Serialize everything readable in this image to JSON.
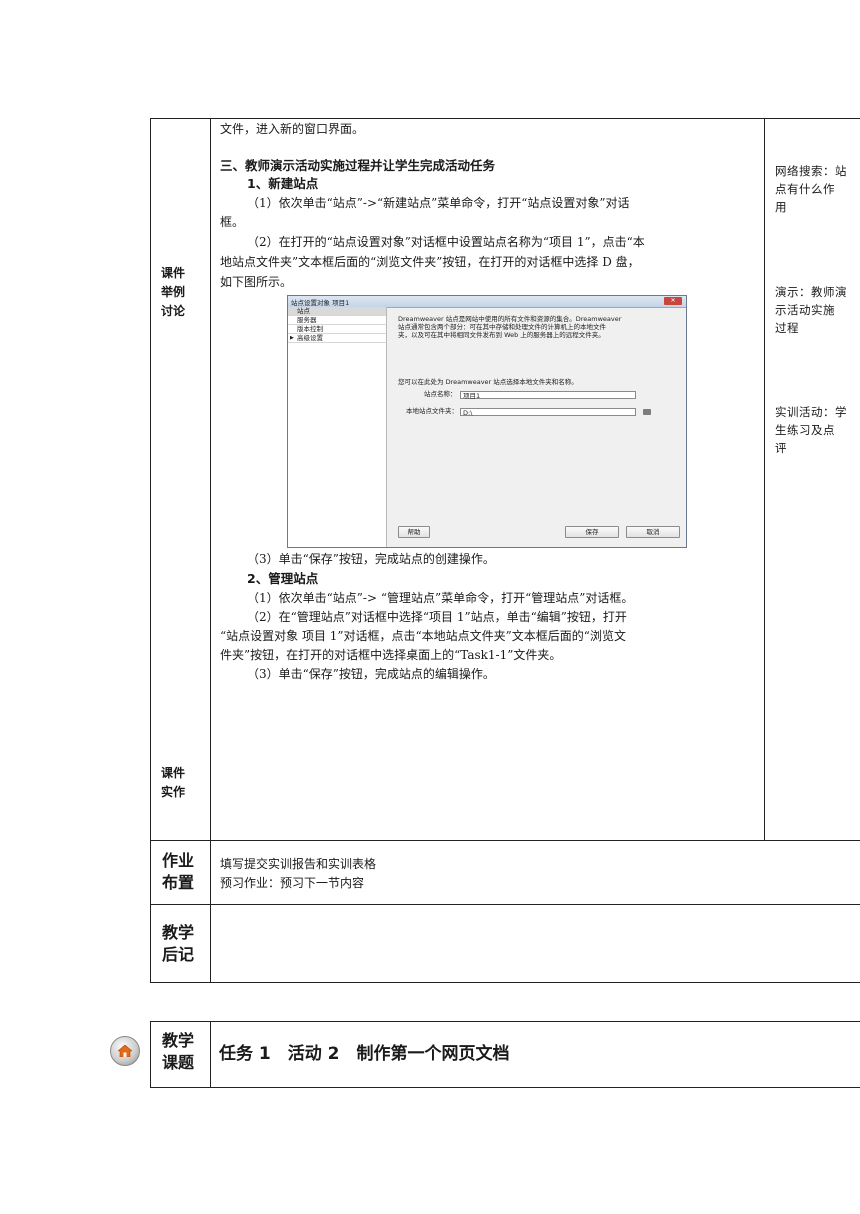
{
  "row_labels": {
    "courseware_example": [
      "课件",
      "举例",
      "讨论"
    ],
    "courseware_practice": [
      "课件",
      "实作"
    ],
    "homework": [
      "作业",
      "布置"
    ],
    "postscript": [
      "教学",
      "后记"
    ],
    "topic": [
      "教学",
      "课题"
    ]
  },
  "content": {
    "lines": [
      "文件，进入新的窗口界面。",
      "三、教师演示活动实施过程并让学生完成活动任务",
      "1、新建站点",
      "（1）依次单击“站点”->“新建站点”菜单命令，打开“站点设置对象”对话",
      "框。",
      "（2）在打开的“站点设置对象”对话框中设置站点名称为“项目 1”，点击“本",
      "地站点文件夹”文本框后面的“浏览文件夹”按钮，在打开的对话框中选择 D 盘，",
      "如下图所示。",
      "（3）单击“保存”按钮，完成站点的创建操作。",
      "2、管理站点",
      "（1）依次单击“站点”-> “管理站点”菜单命令，打开“管理站点”对话框。",
      "（2）在“管理站点”对话框中选择“项目 1”站点，单击“编辑”按钮，打开",
      "“站点设置对象 项目 1”对话框，点击“本地站点文件夹”文本框后面的“浏览文",
      "件夹”按钮，在打开的对话框中选择桌面上的“Task1-1”文件夹。",
      "（3）单击“保存”按钮，完成站点的编辑操作。"
    ]
  },
  "dialog": {
    "title": "站点设置对象 项目1",
    "close": "✕",
    "nav": [
      "站点",
      "服务器",
      "版本控制",
      "高级设置"
    ],
    "description": [
      "Dreamweaver 站点是网站中使用的所有文件和资源的集合。Dreamweaver",
      "站点通常包含两个部分：可在其中存储和处理文件的计算机上的本地文件",
      "夹，以及可在其中将相同文件发布到 Web 上的服务器上的远程文件夹。"
    ],
    "hint": "您可以在此处为 Dreamweaver 站点选择本地文件夹和名称。",
    "site_name_label": "站点名称：",
    "site_name_value": "项目1",
    "local_folder_label": "本地站点文件夹：",
    "local_folder_value": "D:\\",
    "help_button": "帮助",
    "save_button": "保存",
    "cancel_button": "取消"
  },
  "side_notes": [
    [
      "网络搜索：站",
      "点有什么作",
      "用"
    ],
    [
      "演示：教师演",
      "示活动实施",
      "过程"
    ],
    [
      "实训活动：学",
      "生练习及点",
      "评"
    ]
  ],
  "homework": {
    "line1": "填写提交实训报告和实训表格",
    "line2": "预习作业：预习下一节内容"
  },
  "next_topic": {
    "title": "任务 1　活动 2　制作第一个网页文档"
  }
}
